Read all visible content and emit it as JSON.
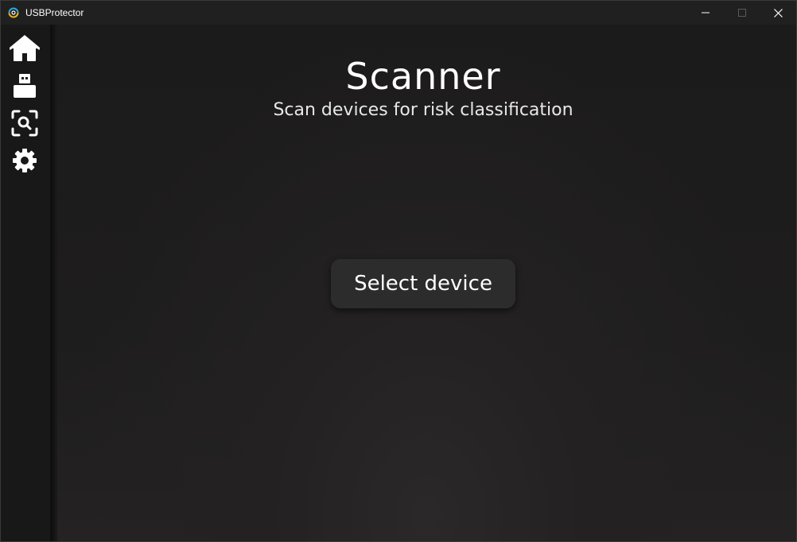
{
  "window": {
    "title": "USBProtector",
    "controls": [
      "minimize-icon",
      "maximize-icon",
      "close-icon"
    ]
  },
  "sidebar": {
    "items": [
      {
        "name": "home",
        "icon": "home-icon"
      },
      {
        "name": "devices",
        "icon": "usb-drive-icon"
      },
      {
        "name": "scanner",
        "icon": "scan-search-icon"
      },
      {
        "name": "settings",
        "icon": "gear-icon"
      }
    ]
  },
  "main": {
    "title": "Scanner",
    "subtitle": "Scan devices for risk classification",
    "select_button_label": "Select device"
  },
  "colors": {
    "background": "#1f1e1e",
    "sidebar": "#191818",
    "titlebar": "#202020",
    "button": "#2d2c2c",
    "text": "#ffffff"
  }
}
